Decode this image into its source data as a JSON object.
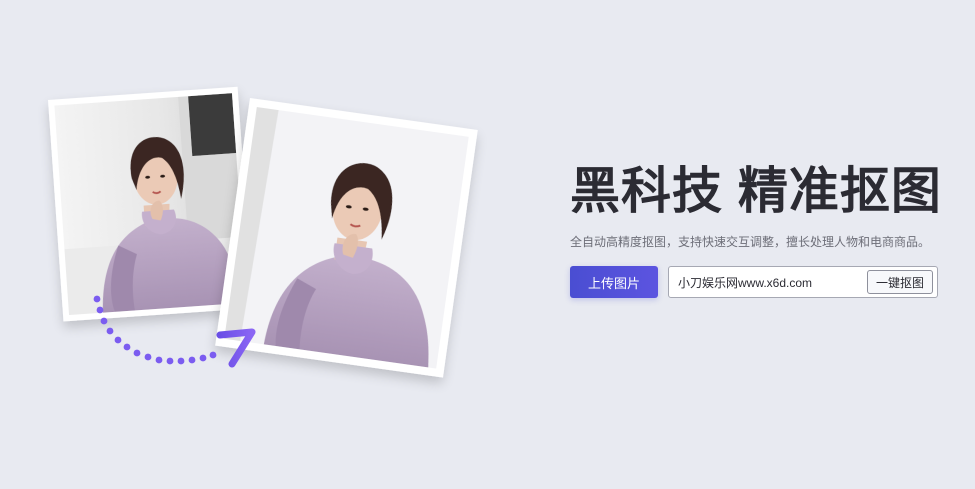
{
  "hero": {
    "headline": "黑科技 精准抠图",
    "subtitle": "全自动高精度抠图，支持快速交互调整，擅长处理人物和电商商品。"
  },
  "actions": {
    "upload_label": "上传图片",
    "url_value": "小刀娱乐网www.x6d.com",
    "cutout_label": "一键抠图"
  },
  "illustration": {
    "arrow_color": "#7b5cf0",
    "sweater_color": "#b49fc0",
    "hair_color": "#3a2622",
    "icons": [
      "original-photo",
      "cutout-photo",
      "dotted-arrow-icon"
    ]
  }
}
